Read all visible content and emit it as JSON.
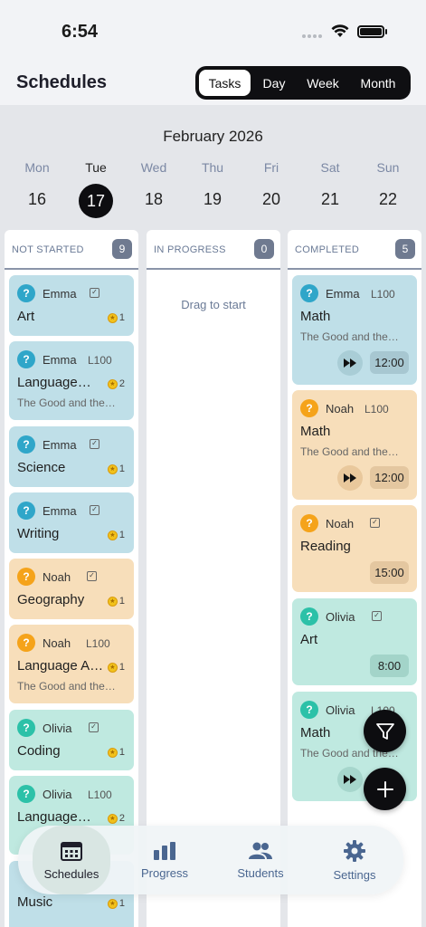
{
  "status": {
    "time": "6:54"
  },
  "header": {
    "title": "Schedules",
    "segments": [
      "Tasks",
      "Day",
      "Week",
      "Month"
    ],
    "active_segment": "Tasks"
  },
  "calendar": {
    "month": "February 2026",
    "days": [
      {
        "name": "Mon",
        "date": "16"
      },
      {
        "name": "Tue",
        "date": "17",
        "today": true
      },
      {
        "name": "Wed",
        "date": "18"
      },
      {
        "name": "Thu",
        "date": "19"
      },
      {
        "name": "Fri",
        "date": "20"
      },
      {
        "name": "Sat",
        "date": "21"
      },
      {
        "name": "Sun",
        "date": "22"
      }
    ]
  },
  "columns": {
    "not_started": {
      "title": "NOT STARTED",
      "count": "9",
      "cards": [
        {
          "student": "Emma",
          "subject": "Art",
          "stars": "1"
        },
        {
          "student": "Emma",
          "level": "L100",
          "subject": "Language…",
          "desc": "The Good and the…",
          "stars": "2"
        },
        {
          "student": "Emma",
          "subject": "Science",
          "stars": "1"
        },
        {
          "student": "Emma",
          "subject": "Writing",
          "stars": "1"
        },
        {
          "student": "Noah",
          "subject": "Geography",
          "stars": "1"
        },
        {
          "student": "Noah",
          "level": "L100",
          "subject": "Language A…",
          "desc": "The Good and the…",
          "stars": "1"
        },
        {
          "student": "Olivia",
          "subject": "Coding",
          "stars": "1"
        },
        {
          "student": "Olivia",
          "level": "L100",
          "subject": "Language…",
          "desc": "The Good and the…",
          "stars": "2"
        },
        {
          "subject": "Music",
          "stars": "1"
        }
      ]
    },
    "in_progress": {
      "title": "IN PROGRESS",
      "count": "0",
      "empty_text": "Drag to start"
    },
    "completed": {
      "title": "COMPLETED",
      "count": "5",
      "cards": [
        {
          "student": "Emma",
          "level": "L100",
          "subject": "Math",
          "desc": "The Good and the…",
          "time": "12:00"
        },
        {
          "student": "Noah",
          "level": "L100",
          "subject": "Math",
          "desc": "The Good and the…",
          "time": "12:00"
        },
        {
          "student": "Noah",
          "subject": "Reading",
          "time": "15:00"
        },
        {
          "student": "Olivia",
          "subject": "Art",
          "time": "8:00"
        },
        {
          "student": "Olivia",
          "level": "L100",
          "subject": "Math",
          "desc": "The Good and the…"
        }
      ]
    }
  },
  "tabs": [
    "Schedules",
    "Progress",
    "Students",
    "Settings"
  ],
  "colors": {
    "blue": "#bfdfe8",
    "orange": "#f7deba",
    "teal": "#bfe9e0",
    "accent": "#0d0d10"
  }
}
